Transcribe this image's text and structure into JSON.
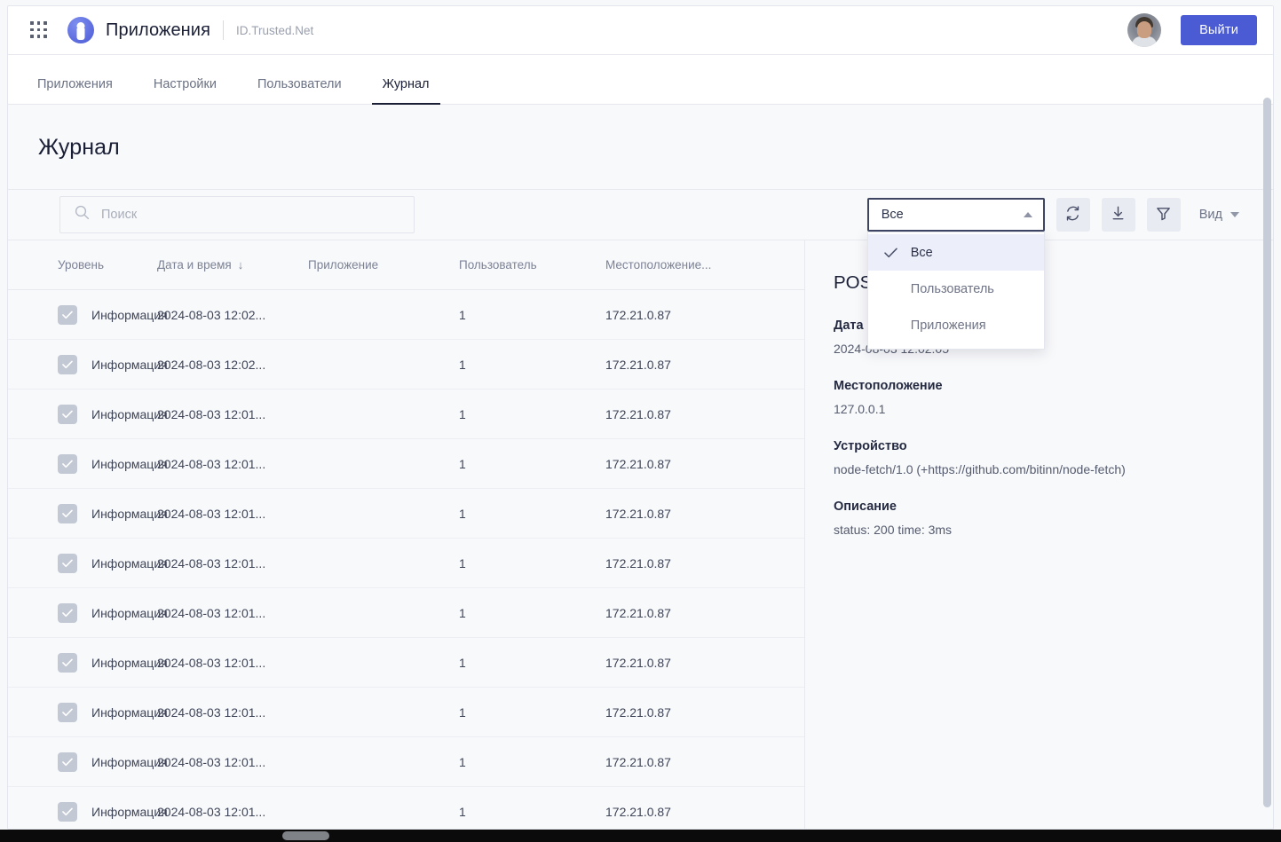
{
  "topbar": {
    "grid_icon": "apps-grid-icon",
    "logo_icon": "trusted-net-logo-icon",
    "title": "Приложения",
    "subtitle": "ID.Trusted.Net",
    "avatar_alt": "user-avatar",
    "logout_label": "Выйти",
    "accent_color": "#4a5bd4"
  },
  "tabs": [
    {
      "label": "Приложения",
      "active": false
    },
    {
      "label": "Настройки",
      "active": false
    },
    {
      "label": "Пользователи",
      "active": false
    },
    {
      "label": "Журнал",
      "active": true
    }
  ],
  "page": {
    "title": "Журнал"
  },
  "toolbar": {
    "search_placeholder": "Поиск",
    "search_value": "",
    "search_icon": "search-icon",
    "select": {
      "value": "Все",
      "expanded": true,
      "caret_icon": "caret-up-icon",
      "options": [
        {
          "label": "Все",
          "selected": true
        },
        {
          "label": "Пользователь",
          "selected": false
        },
        {
          "label": "Приложения",
          "selected": false
        }
      ]
    },
    "buttons": [
      {
        "name": "refresh-button",
        "icon": "refresh-icon"
      },
      {
        "name": "download-button",
        "icon": "download-icon"
      },
      {
        "name": "filter-button",
        "icon": "filter-icon"
      }
    ],
    "view_label": "Вид",
    "view_caret_icon": "chevron-down-icon"
  },
  "table": {
    "columns": [
      {
        "key": "level",
        "label": "Уровень",
        "sorted": false
      },
      {
        "key": "datetime",
        "label": "Дата и время",
        "sorted": true,
        "sort_icon": "↓"
      },
      {
        "key": "application",
        "label": "Приложение",
        "sorted": false
      },
      {
        "key": "user",
        "label": "Пользователь",
        "sorted": false
      },
      {
        "key": "location",
        "label": "Местоположение...",
        "sorted": false
      }
    ],
    "rows": [
      {
        "checked": true,
        "level": "Информация",
        "datetime": "2024-08-03 12:02...",
        "application": "",
        "user": "1",
        "location": "172.21.0.87"
      },
      {
        "checked": true,
        "level": "Информация",
        "datetime": "2024-08-03 12:02...",
        "application": "",
        "user": "1",
        "location": "172.21.0.87"
      },
      {
        "checked": true,
        "level": "Информация",
        "datetime": "2024-08-03 12:01...",
        "application": "",
        "user": "1",
        "location": "172.21.0.87"
      },
      {
        "checked": true,
        "level": "Информация",
        "datetime": "2024-08-03 12:01...",
        "application": "",
        "user": "1",
        "location": "172.21.0.87"
      },
      {
        "checked": true,
        "level": "Информация",
        "datetime": "2024-08-03 12:01...",
        "application": "",
        "user": "1",
        "location": "172.21.0.87"
      },
      {
        "checked": true,
        "level": "Информация",
        "datetime": "2024-08-03 12:01...",
        "application": "",
        "user": "1",
        "location": "172.21.0.87"
      },
      {
        "checked": true,
        "level": "Информация",
        "datetime": "2024-08-03 12:01...",
        "application": "",
        "user": "1",
        "location": "172.21.0.87"
      },
      {
        "checked": true,
        "level": "Информация",
        "datetime": "2024-08-03 12:01...",
        "application": "",
        "user": "1",
        "location": "172.21.0.87"
      },
      {
        "checked": true,
        "level": "Информация",
        "datetime": "2024-08-03 12:01...",
        "application": "",
        "user": "1",
        "location": "172.21.0.87"
      },
      {
        "checked": true,
        "level": "Информация",
        "datetime": "2024-08-03 12:01...",
        "application": "",
        "user": "1",
        "location": "172.21.0.87"
      },
      {
        "checked": true,
        "level": "Информация",
        "datetime": "2024-08-03 12:01...",
        "application": "",
        "user": "1",
        "location": "172.21.0.87"
      }
    ]
  },
  "detail": {
    "title": "POST /api/authentication",
    "fields": [
      {
        "label": "Дата и время",
        "value": "2024-08-03 12:02:05"
      },
      {
        "label": "Местоположение",
        "value": "127.0.0.1"
      },
      {
        "label": "Устройство",
        "value": "node-fetch/1.0 (+https://github.com/bitinn/node-fetch)"
      },
      {
        "label": "Описание",
        "value": "status: 200 time: 3ms"
      }
    ]
  }
}
